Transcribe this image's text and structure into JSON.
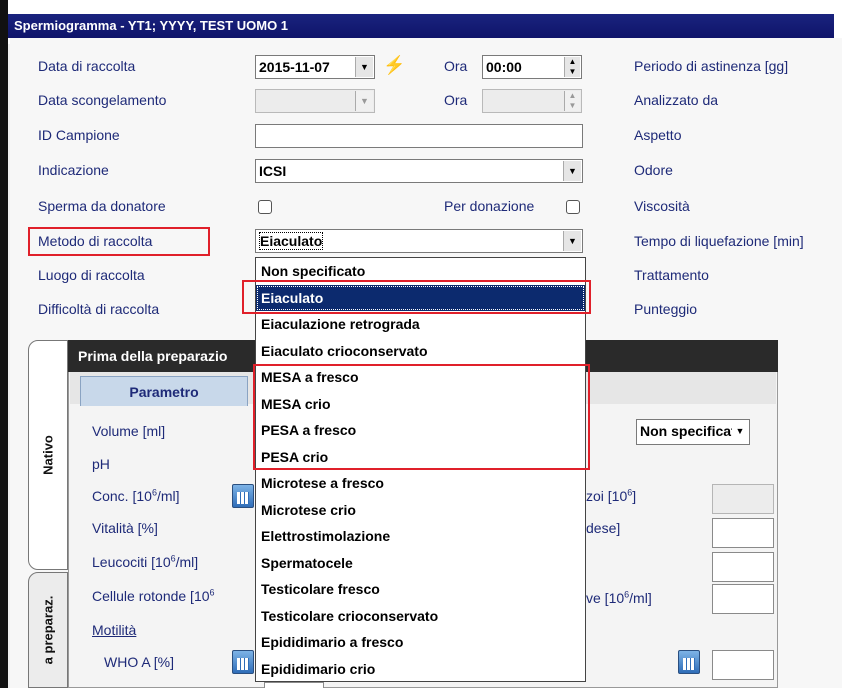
{
  "window": {
    "title": "Spermiogramma - YT1; YYYY, TEST UOMO 1"
  },
  "form": {
    "data_raccolta_label": "Data di raccolta",
    "data_raccolta_value": "2015-11-07",
    "ora_label": "Ora",
    "ora_value": "00:00",
    "ora2_label": "Ora",
    "data_scongelamento_label": "Data scongelamento",
    "id_campione_label": "ID Campione",
    "indicazione_label": "Indicazione",
    "indicazione_value": "ICSI",
    "sperma_donatore_label": "Sperma da donatore",
    "per_donazione_label": "Per donazione",
    "metodo_raccolta_label": "Metodo di raccolta",
    "metodo_raccolta_value": "Eiaculato",
    "luogo_raccolta_label": "Luogo di raccolta",
    "difficolta_raccolta_label": "Difficoltà di raccolta"
  },
  "right_labels": {
    "periodo": "Periodo di astinenza [gg]",
    "analizzato": "Analizzato da",
    "aspetto": "Aspetto",
    "odore": "Odore",
    "viscosita": "Viscosità",
    "tempo": "Tempo di liquefazione [min]",
    "trattamento": "Trattamento",
    "punteggio": "Punteggio"
  },
  "panel": {
    "header": "Prima della preparazio",
    "tab_param": "Parametro",
    "volume": "Volume [ml]",
    "ph": "pH",
    "conc": "Conc. [10",
    "conc_sup": "6",
    "conc_unit": "/ml]",
    "vitalita": "Vitalità [%]",
    "leucociti": "Leucociti [10",
    "leucociti_sup": "6",
    "leucociti_unit": "/ml]",
    "cellule": "Cellule rotonde [10",
    "cellule_sup": "6",
    "motilita": "Motilità",
    "who_a": "WHO A [%]",
    "right_select": "Non specificat",
    "r_zoi": "zoi [10",
    "r_zoi_sup": "6",
    "r_zoi_end": "]",
    "r_dese": "dese]",
    "r_ve": "ve [10",
    "r_ve_sup": "6",
    "r_ve_unit": "/ml]"
  },
  "side_tabs": {
    "nativo": "Nativo",
    "preparaz": "a preparaz."
  },
  "dropdown_options": [
    "Non specificato",
    "Eiaculato",
    "Eiaculazione retrograda",
    "Eiaculato crioconservato",
    "MESA a fresco",
    "MESA crio",
    "PESA a fresco",
    "PESA crio",
    "Microtese a fresco",
    "Microtese crio",
    "Elettrostimolazione",
    "Spermatocele",
    "Testicolare fresco",
    "Testicolare crioconservato",
    "Epididimario a fresco",
    "Epididimario crio"
  ],
  "colors": {
    "title_bar": "#1a237e",
    "highlight": "#e0202a",
    "selected": "#0c2a6e"
  }
}
